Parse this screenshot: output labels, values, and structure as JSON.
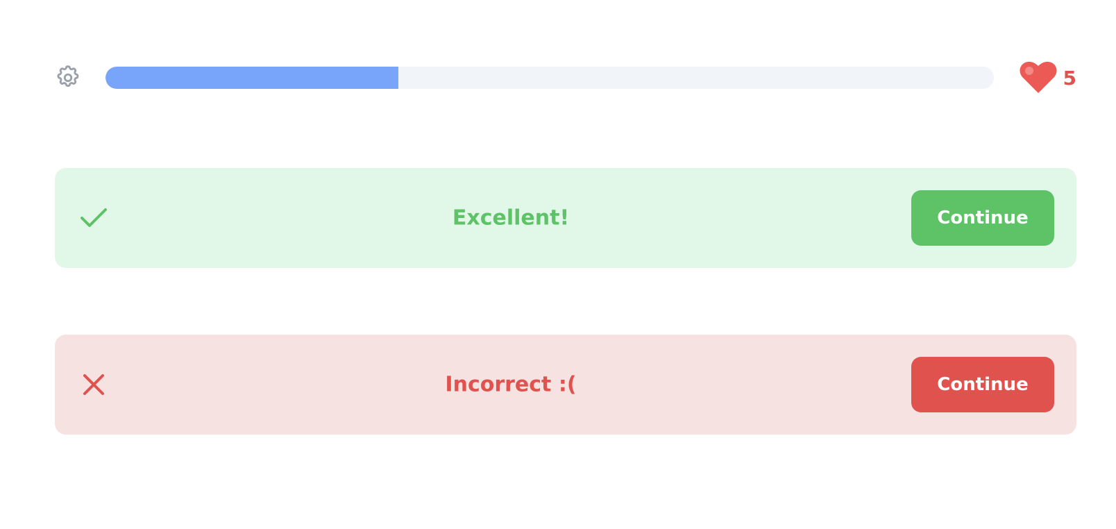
{
  "header": {
    "settings_icon": "gear-icon",
    "progress_fraction": 0.33,
    "progress_color": "#78a5fa",
    "progress_track_color": "#f1f4f9",
    "lives_icon": "heart-icon",
    "lives_count": "5",
    "lives_color": "#e0524d"
  },
  "feedback": {
    "success": {
      "icon": "check-icon",
      "message": "Excellent!",
      "button_label": "Continue",
      "accent_color": "#5ec266",
      "background_color": "#e1f8e9"
    },
    "error": {
      "icon": "close-icon",
      "message": "Incorrect :(",
      "button_label": "Continue",
      "accent_color": "#e0524d",
      "background_color": "#f7e2e2"
    }
  }
}
